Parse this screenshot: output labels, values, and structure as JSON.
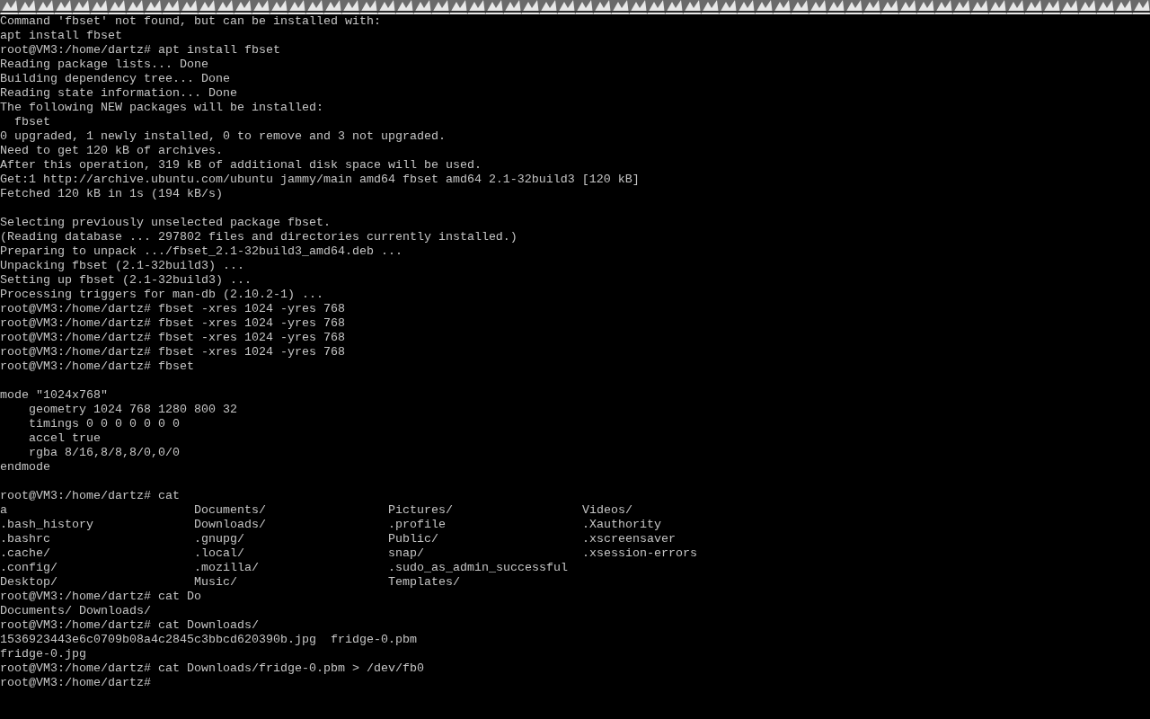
{
  "lines": [
    {
      "kind": "text",
      "text": "Command 'fbset' not found, but can be installed with:"
    },
    {
      "kind": "text",
      "text": "apt install fbset"
    },
    {
      "kind": "text",
      "text": "root@VM3:/home/dartz# apt install fbset"
    },
    {
      "kind": "text",
      "text": "Reading package lists... Done"
    },
    {
      "kind": "text",
      "text": "Building dependency tree... Done"
    },
    {
      "kind": "text",
      "text": "Reading state information... Done"
    },
    {
      "kind": "text",
      "text": "The following NEW packages will be installed:"
    },
    {
      "kind": "text",
      "text": "  fbset"
    },
    {
      "kind": "text",
      "text": "0 upgraded, 1 newly installed, 0 to remove and 3 not upgraded."
    },
    {
      "kind": "text",
      "text": "Need to get 120 kB of archives."
    },
    {
      "kind": "text",
      "text": "After this operation, 319 kB of additional disk space will be used."
    },
    {
      "kind": "text",
      "text": "Get:1 http://archive.ubuntu.com/ubuntu jammy/main amd64 fbset amd64 2.1-32build3 [120 kB]"
    },
    {
      "kind": "text",
      "text": "Fetched 120 kB in 1s (194 kB/s)"
    },
    {
      "kind": "blank"
    },
    {
      "kind": "text",
      "text": "Selecting previously unselected package fbset."
    },
    {
      "kind": "text",
      "text": "(Reading database ... 297802 files and directories currently installed.)"
    },
    {
      "kind": "text",
      "text": "Preparing to unpack .../fbset_2.1-32build3_amd64.deb ..."
    },
    {
      "kind": "text",
      "text": "Unpacking fbset (2.1-32build3) ..."
    },
    {
      "kind": "text",
      "text": "Setting up fbset (2.1-32build3) ..."
    },
    {
      "kind": "text",
      "text": "Processing triggers for man-db (2.10.2-1) ..."
    },
    {
      "kind": "text",
      "text": "root@VM3:/home/dartz# fbset -xres 1024 -yres 768"
    },
    {
      "kind": "text",
      "text": "root@VM3:/home/dartz# fbset -xres 1024 -yres 768"
    },
    {
      "kind": "text",
      "text": "root@VM3:/home/dartz# fbset -xres 1024 -yres 768"
    },
    {
      "kind": "text",
      "text": "root@VM3:/home/dartz# fbset -xres 1024 -yres 768"
    },
    {
      "kind": "text",
      "text": "root@VM3:/home/dartz# fbset"
    },
    {
      "kind": "blank"
    },
    {
      "kind": "text",
      "text": "mode \"1024x768\""
    },
    {
      "kind": "text",
      "text": "    geometry 1024 768 1280 800 32"
    },
    {
      "kind": "text",
      "text": "    timings 0 0 0 0 0 0 0"
    },
    {
      "kind": "text",
      "text": "    accel true"
    },
    {
      "kind": "text",
      "text": "    rgba 8/16,8/8,8/0,0/0"
    },
    {
      "kind": "text",
      "text": "endmode"
    },
    {
      "kind": "blank"
    },
    {
      "kind": "text",
      "text": "root@VM3:/home/dartz# cat"
    },
    {
      "kind": "columns",
      "cells": [
        "a",
        "Documents/",
        "Pictures/",
        "Videos/"
      ]
    },
    {
      "kind": "columns",
      "cells": [
        ".bash_history",
        "Downloads/",
        ".profile",
        ".Xauthority"
      ]
    },
    {
      "kind": "columns",
      "cells": [
        ".bashrc",
        ".gnupg/",
        "Public/",
        ".xscreensaver"
      ]
    },
    {
      "kind": "columns",
      "cells": [
        ".cache/",
        ".local/",
        "snap/",
        ".xsession-errors"
      ]
    },
    {
      "kind": "columns",
      "cells": [
        ".config/",
        ".mozilla/",
        ".sudo_as_admin_successful"
      ]
    },
    {
      "kind": "columns",
      "cells": [
        "Desktop/",
        "Music/",
        "Templates/"
      ]
    },
    {
      "kind": "text",
      "text": "root@VM3:/home/dartz# cat Do"
    },
    {
      "kind": "text",
      "text": "Documents/ Downloads/"
    },
    {
      "kind": "text",
      "text": "root@VM3:/home/dartz# cat Downloads/"
    },
    {
      "kind": "text",
      "text": "1536923443e6c0709b08a4c2845c3bbcd620390b.jpg  fridge-0.pbm"
    },
    {
      "kind": "text",
      "text": "fridge-0.jpg"
    },
    {
      "kind": "text",
      "text": "root@VM3:/home/dartz# cat Downloads/fridge-0.pbm > /dev/fb0"
    },
    {
      "kind": "text",
      "text": "root@VM3:/home/dartz#"
    }
  ]
}
